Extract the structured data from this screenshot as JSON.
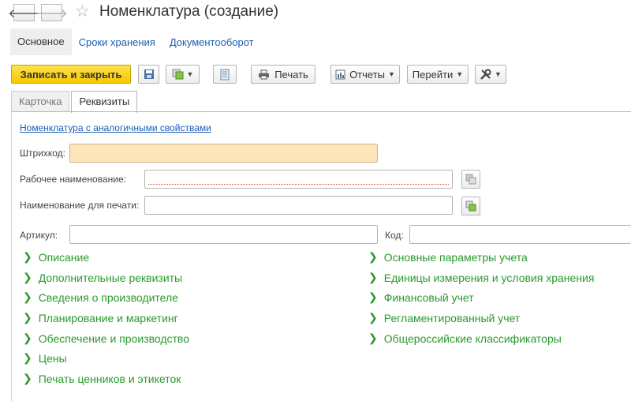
{
  "window": {
    "title": "Номенклатура (создание)"
  },
  "nav": {
    "back": "🡐",
    "forward": "🡒",
    "star": "☆"
  },
  "subnav": {
    "items": [
      "Основное",
      "Сроки хранения",
      "Документооборот"
    ]
  },
  "toolbar": {
    "save_close": "Записать и закрыть",
    "print": "Печать",
    "reports": "Отчеты",
    "goto": "Перейти"
  },
  "tabs": [
    "Карточка",
    "Реквизиты"
  ],
  "form": {
    "similar_link": "Номенклатура с аналогичными свойствами",
    "barcode_label": "Штрихкод:",
    "work_name_label": "Рабочее наименование:",
    "print_name_label": "Наименование для печати:",
    "article_label": "Артикул:",
    "code_label": "Код:",
    "barcode_value": "",
    "work_name_value": "",
    "print_name_value": "",
    "article_value": "",
    "code_value": ""
  },
  "groups_left": [
    "Описание",
    "Дополнительные реквизиты",
    "Сведения о производителе",
    "Планирование и маркетинг",
    "Обеспечение и производство",
    "Цены",
    "Печать ценников и этикеток"
  ],
  "groups_right": [
    "Основные параметры учета",
    "Единицы измерения и условия хранения",
    "Финансовый учет",
    "Регламентированный учет",
    "Общероссийские классификаторы"
  ],
  "colors": {
    "accent_green": "#2a9a2e",
    "link_blue": "#1c5db5",
    "primary_yellow": "#f4c800",
    "required_bg": "#ffe4bb"
  }
}
